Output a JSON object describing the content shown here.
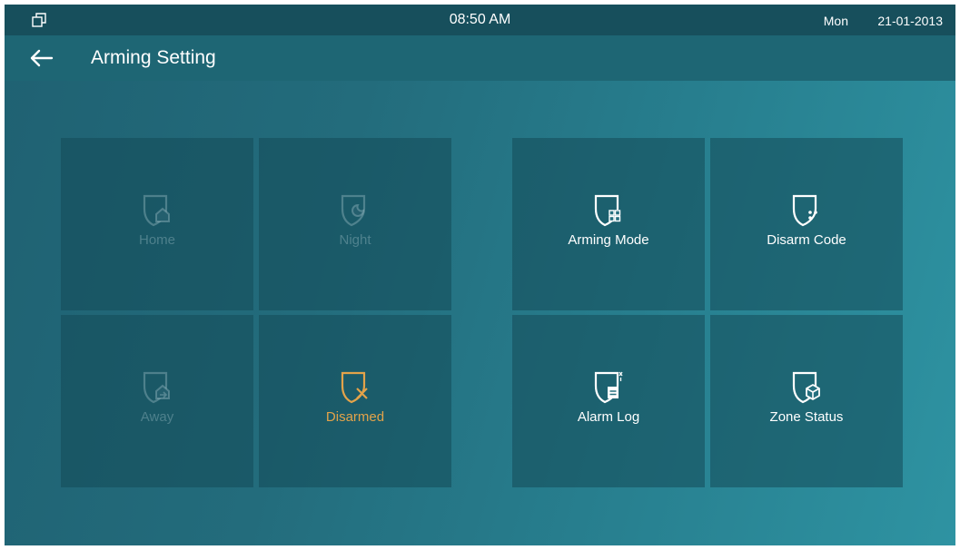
{
  "status_bar": {
    "time": "08:50 AM",
    "day": "Mon",
    "date": "21-01-2013"
  },
  "header": {
    "title": "Arming Setting"
  },
  "mode_tiles": [
    {
      "label": "Home",
      "icon": "shield-home-icon",
      "state": "disabled"
    },
    {
      "label": "Night",
      "icon": "shield-moon-icon",
      "state": "disabled"
    },
    {
      "label": "Away",
      "icon": "shield-away-icon",
      "state": "disabled"
    },
    {
      "label": "Disarmed",
      "icon": "shield-x-icon",
      "state": "active"
    }
  ],
  "setting_tiles": [
    {
      "label": "Arming Mode",
      "icon": "shield-grid-icon"
    },
    {
      "label": "Disarm Code",
      "icon": "shield-key-icon"
    },
    {
      "label": "Alarm Log",
      "icon": "shield-log-icon"
    },
    {
      "label": "Zone Status",
      "icon": "shield-cube-icon"
    }
  ],
  "colors": {
    "status_bar": "#174f5c",
    "header": "#1e6674",
    "active_accent": "#e3a34a",
    "disabled_text": "#bed7dc"
  }
}
